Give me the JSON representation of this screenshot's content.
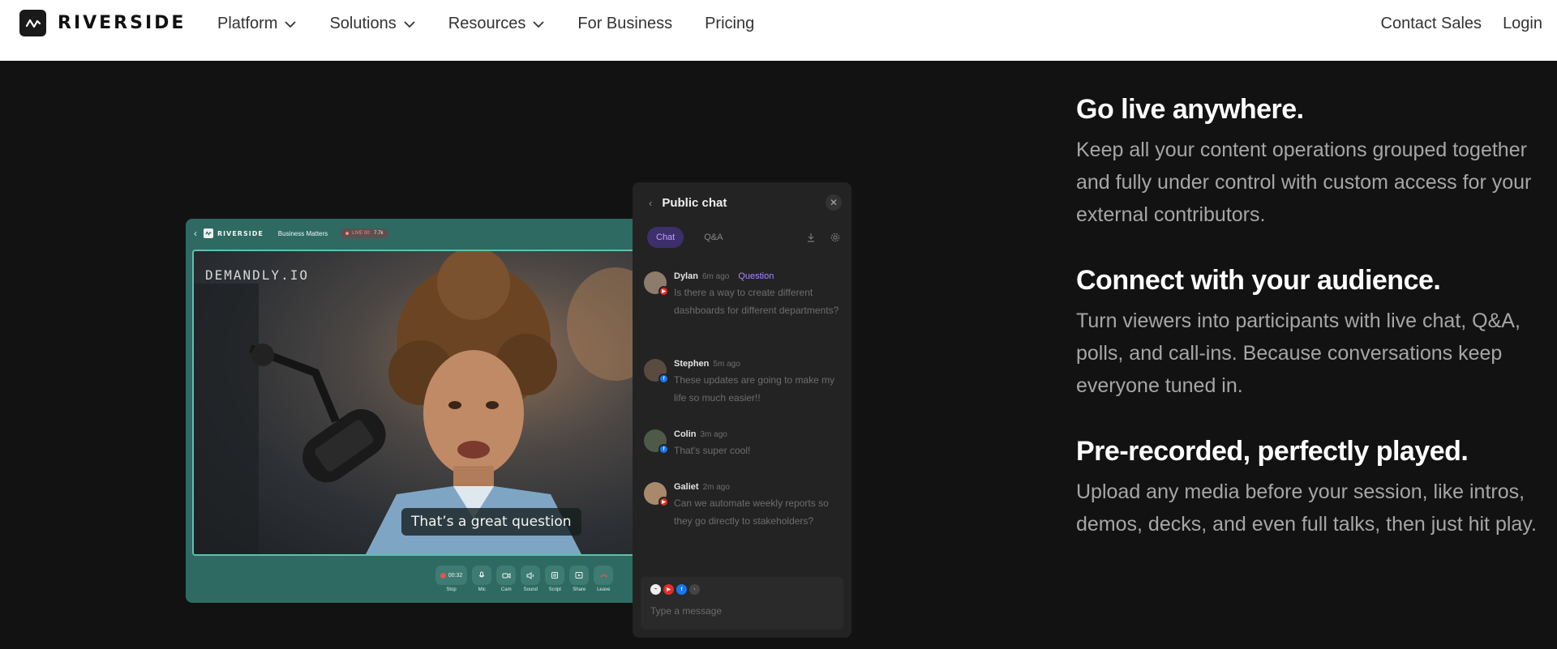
{
  "nav": {
    "brand": "RIVERSIDE",
    "links": [
      {
        "label": "Platform",
        "dropdown": true
      },
      {
        "label": "Solutions",
        "dropdown": true
      },
      {
        "label": "Resources",
        "dropdown": true
      },
      {
        "label": "For Business",
        "dropdown": false
      },
      {
        "label": "Pricing",
        "dropdown": false
      }
    ],
    "contact": "Contact Sales",
    "login": "Login"
  },
  "studio": {
    "brand": "RIVERSIDE",
    "title": "Business Matters",
    "live_label": "LIVE 00:",
    "live_count": "7.7k",
    "watermark": "DEMANDLY.IO",
    "caption": "That’s a great question",
    "controls": [
      {
        "label": "Stop",
        "value": "00:32"
      },
      {
        "label": "Mic"
      },
      {
        "label": "Cam"
      },
      {
        "label": "Sound"
      },
      {
        "label": "Script"
      },
      {
        "label": "Share"
      },
      {
        "label": "Leave"
      }
    ]
  },
  "chat": {
    "title": "Public chat",
    "tabs": [
      "Chat",
      "Q&A"
    ],
    "messages": [
      {
        "name": "Dylan",
        "time": "6m ago",
        "tag": "Question",
        "text": "Is there a way to create different dashboards for different departments?",
        "platform": "youtube"
      },
      {
        "name": "Stephen",
        "time": "5m ago",
        "tag": "",
        "text": "These updates are going to make my life so much easier!!",
        "platform": "facebook"
      },
      {
        "name": "Colin",
        "time": "3m ago",
        "tag": "",
        "text": "That's super cool!",
        "platform": "facebook"
      },
      {
        "name": "Galiet",
        "time": "2m ago",
        "tag": "",
        "text": "Can we automate weekly reports so they go directly to stakeholders?",
        "platform": "youtube"
      }
    ],
    "compose_placeholder": "Type a message"
  },
  "features": [
    {
      "title": "Go live anywhere.",
      "body": "Keep all your content operations grouped together and fully under control with custom access for your external contributors."
    },
    {
      "title": "Connect with your audience.",
      "body": "Turn viewers into participants with live chat, Q&A, polls, and call-ins. Because conversations keep everyone tuned in."
    },
    {
      "title": "Pre-recorded, perfectly played.",
      "body": "Upload any media before your session, like intros, demos, decks, and even full talks, then just hit play."
    }
  ],
  "colors": {
    "background": "#121212",
    "studio_teal": "#2e6a62",
    "chat_accent": "#b8a3ff",
    "youtube": "#e52d27",
    "facebook": "#1877f2"
  }
}
